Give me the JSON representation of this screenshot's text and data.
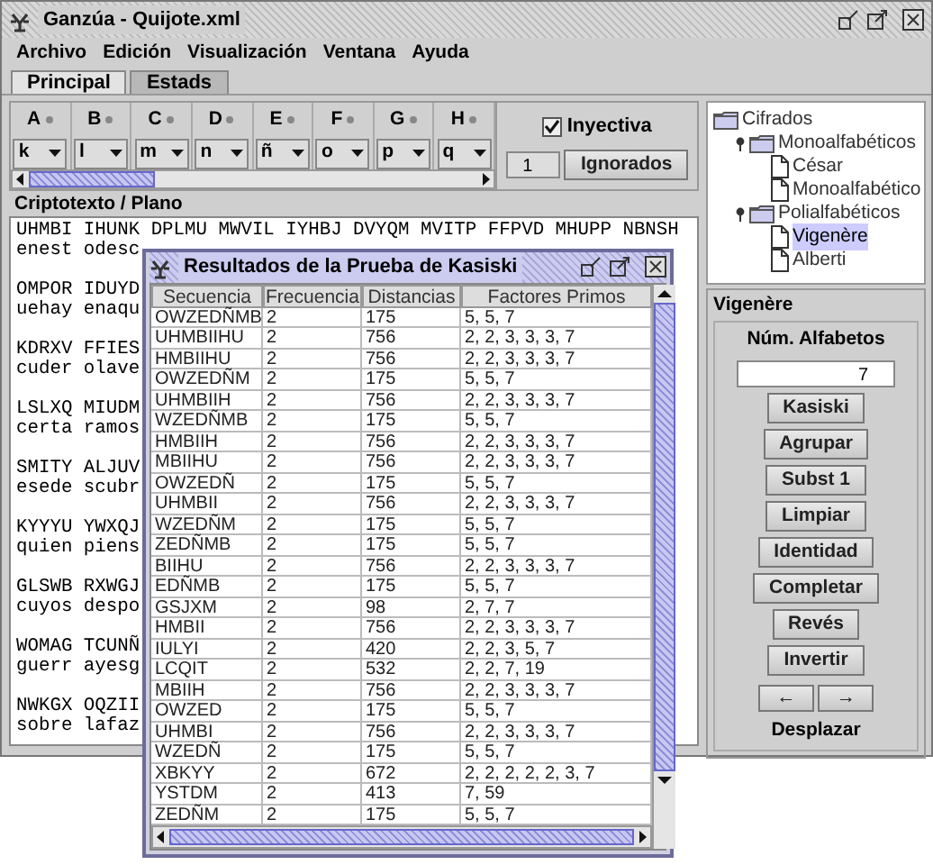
{
  "window": {
    "title": "Ganzúa - Quijote.xml"
  },
  "menu": [
    "Archivo",
    "Edición",
    "Visualización",
    "Ventana",
    "Ayuda"
  ],
  "tabs": [
    {
      "label": "Principal",
      "selected": true
    },
    {
      "label": "Estads",
      "selected": false
    }
  ],
  "mappings": [
    {
      "from": "A",
      "to": "k"
    },
    {
      "from": "B",
      "to": "l"
    },
    {
      "from": "C",
      "to": "m"
    },
    {
      "from": "D",
      "to": "n"
    },
    {
      "from": "E",
      "to": "ñ"
    },
    {
      "from": "F",
      "to": "o"
    },
    {
      "from": "G",
      "to": "p"
    },
    {
      "from": "H",
      "to": "q"
    }
  ],
  "inyectiva": {
    "label": "Inyectiva",
    "checked": true
  },
  "spinner": {
    "value": "1"
  },
  "ignorados_button": "Ignorados",
  "text_panel": {
    "title": "Criptotexto / Plano",
    "blocks": [
      [
        "UHMBI IHUNK DPLMU MWVIL IYHBJ DVYQM MVITP FFPVD MHUPP NBNSH",
        "enest odesc"
      ],
      [
        "OMPOR IDUYD",
        "uehay enaqu"
      ],
      [
        "KDRXV FFIES",
        "cuder olave"
      ],
      [
        "LSLXQ MIUDM",
        "certa ramos"
      ],
      [
        "SMITY ALJUV",
        "esede scubr"
      ],
      [
        "KYYYU YWXQJ",
        "quien piens"
      ],
      [
        "GLSWB RXWGJ",
        "cuyos despo"
      ],
      [
        "WOMAG TCUNÑ",
        "guerr ayesg"
      ],
      [
        "NWKGX OQZII",
        "sobre lafaz"
      ]
    ]
  },
  "tree": [
    {
      "label": "Cifrados",
      "kind": "folder",
      "selected": false,
      "children": [
        {
          "label": "Monoalfabéticos",
          "kind": "folder",
          "selected": false,
          "children": [
            {
              "label": "César",
              "kind": "leaf",
              "selected": false
            },
            {
              "label": "Monoalfabético",
              "kind": "leaf",
              "selected": false
            }
          ]
        },
        {
          "label": "Polialfabéticos",
          "kind": "folder",
          "selected": false,
          "children": [
            {
              "label": "Vigenère",
              "kind": "leaf",
              "selected": true
            },
            {
              "label": "Alberti",
              "kind": "leaf",
              "selected": false
            }
          ]
        }
      ]
    }
  ],
  "vigenere": {
    "title": "Vigenère",
    "num_label": "Núm. Alfabetos",
    "num_value": "7",
    "buttons": [
      "Kasiski",
      "Agrupar",
      "Subst 1",
      "Limpiar",
      "Identidad",
      "Completar",
      "Revés",
      "Invertir"
    ],
    "arrows": [
      "←",
      "→"
    ],
    "shift_label": "Desplazar"
  },
  "dialog": {
    "title": "Resultados de la Prueba de Kasiski",
    "columns": [
      "Secuencia",
      "Frecuencia",
      "Distancias",
      "Factores Primos"
    ],
    "rows": [
      [
        "OWZEDÑMB",
        "2",
        "175",
        "5, 5, 7"
      ],
      [
        "UHMBIIHU",
        "2",
        "756",
        "2, 2, 3, 3, 3, 7"
      ],
      [
        "HMBIIHU",
        "2",
        "756",
        "2, 2, 3, 3, 3, 7"
      ],
      [
        "OWZEDÑM",
        "2",
        "175",
        "5, 5, 7"
      ],
      [
        "UHMBIIH",
        "2",
        "756",
        "2, 2, 3, 3, 3, 7"
      ],
      [
        "WZEDÑMB",
        "2",
        "175",
        "5, 5, 7"
      ],
      [
        "HMBIIH",
        "2",
        "756",
        "2, 2, 3, 3, 3, 7"
      ],
      [
        "MBIIHU",
        "2",
        "756",
        "2, 2, 3, 3, 3, 7"
      ],
      [
        "OWZEDÑ",
        "2",
        "175",
        "5, 5, 7"
      ],
      [
        "UHMBII",
        "2",
        "756",
        "2, 2, 3, 3, 3, 7"
      ],
      [
        "WZEDÑM",
        "2",
        "175",
        "5, 5, 7"
      ],
      [
        "ZEDÑMB",
        "2",
        "175",
        "5, 5, 7"
      ],
      [
        "BIIHU",
        "2",
        "756",
        "2, 2, 3, 3, 3, 7"
      ],
      [
        "EDÑMB",
        "2",
        "175",
        "5, 5, 7"
      ],
      [
        "GSJXM",
        "2",
        "98",
        "2, 7, 7"
      ],
      [
        "HMBII",
        "2",
        "756",
        "2, 2, 3, 3, 3, 7"
      ],
      [
        "IULYI",
        "2",
        "420",
        "2, 2, 3, 5, 7"
      ],
      [
        "LCQIT",
        "2",
        "532",
        "2, 2, 7, 19"
      ],
      [
        "MBIIH",
        "2",
        "756",
        "2, 2, 3, 3, 3, 7"
      ],
      [
        "OWZED",
        "2",
        "175",
        "5, 5, 7"
      ],
      [
        "UHMBI",
        "2",
        "756",
        "2, 2, 3, 3, 3, 7"
      ],
      [
        "WZEDÑ",
        "2",
        "175",
        "5, 5, 7"
      ],
      [
        "XBKYY",
        "2",
        "672",
        "2, 2, 2, 2, 2, 3, 7"
      ],
      [
        "YSTDM",
        "2",
        "413",
        "7, 59"
      ],
      [
        "ZEDÑM",
        "2",
        "175",
        "5, 5, 7"
      ]
    ]
  }
}
